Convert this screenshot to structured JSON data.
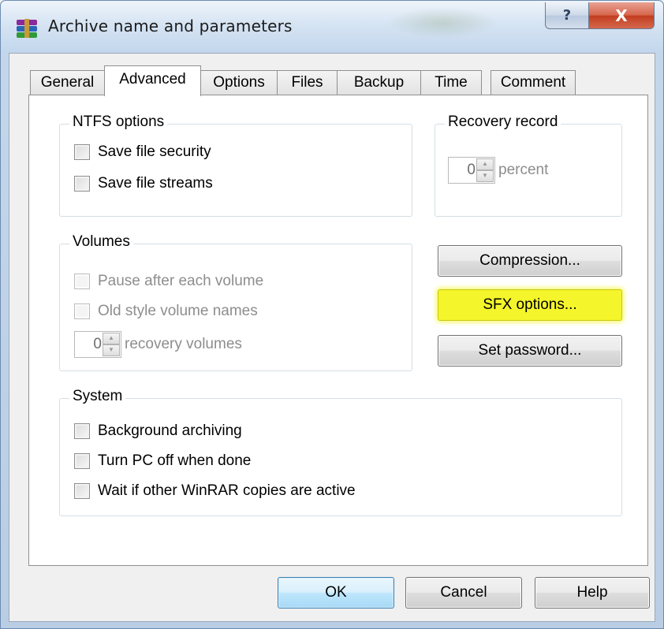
{
  "window": {
    "title": "Archive name and parameters",
    "title_blur_text": "",
    "help_caption": "?",
    "close_caption": "X"
  },
  "tabs": [
    {
      "label": "General"
    },
    {
      "label": "Advanced"
    },
    {
      "label": "Options"
    },
    {
      "label": "Files"
    },
    {
      "label": "Backup"
    },
    {
      "label": "Time"
    },
    {
      "label": "Comment"
    }
  ],
  "active_tab": "Advanced",
  "ntfs": {
    "legend": "NTFS options",
    "save_security": "Save file security",
    "save_streams": "Save file streams"
  },
  "recovery": {
    "legend": "Recovery record",
    "value": "0",
    "unit": "percent"
  },
  "volumes": {
    "legend": "Volumes",
    "pause": "Pause after each volume",
    "old_style": "Old style volume names",
    "recovery_value": "0",
    "recovery_label": "recovery volumes"
  },
  "buttons": {
    "compression": "Compression...",
    "sfx": "SFX options...",
    "password": "Set password...",
    "ok": "OK",
    "cancel": "Cancel",
    "help": "Help"
  },
  "system": {
    "legend": "System",
    "background": "Background archiving",
    "turn_off": "Turn PC off when done",
    "wait": "Wait if other WinRAR copies are active"
  },
  "colors": {
    "highlight": "#f4f52a",
    "close_button": "#c9472b"
  }
}
